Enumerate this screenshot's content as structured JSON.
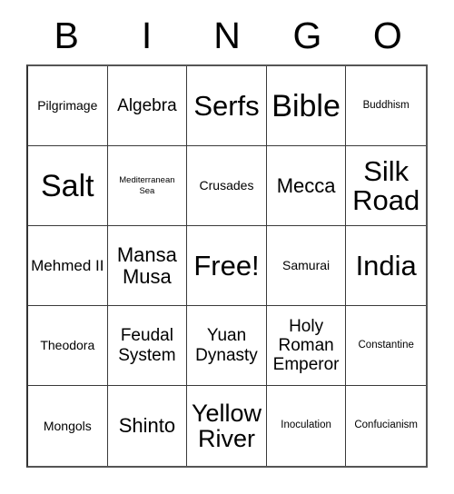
{
  "header": {
    "letters": [
      "B",
      "I",
      "N",
      "G",
      "O"
    ]
  },
  "grid": {
    "rows": 5,
    "columns": 5,
    "cells": [
      {
        "text": "Pilgrimage",
        "size": "fs-s"
      },
      {
        "text": "Algebra",
        "size": "fs-ml"
      },
      {
        "text": "Serfs",
        "size": "fs-xxl"
      },
      {
        "text": "Bible",
        "size": "fs-hg"
      },
      {
        "text": "Buddhism",
        "size": "fs-xs"
      },
      {
        "text": "Salt",
        "size": "fs-hg"
      },
      {
        "text": "Mediterranean Sea",
        "size": "fs-xxs"
      },
      {
        "text": "Crusades",
        "size": "fs-s"
      },
      {
        "text": "Mecca",
        "size": "fs-l"
      },
      {
        "text": "Silk Road",
        "size": "fs-xxl"
      },
      {
        "text": "Mehmed II",
        "size": "fs-m"
      },
      {
        "text": "Mansa Musa",
        "size": "fs-l"
      },
      {
        "text": "Free!",
        "size": "fs-xxl"
      },
      {
        "text": "Samurai",
        "size": "fs-s"
      },
      {
        "text": "India",
        "size": "fs-xxl"
      },
      {
        "text": "Theodora",
        "size": "fs-s"
      },
      {
        "text": "Feudal System",
        "size": "fs-ml"
      },
      {
        "text": "Yuan Dynasty",
        "size": "fs-ml"
      },
      {
        "text": "Holy Roman Emperor",
        "size": "fs-ml"
      },
      {
        "text": "Constantine",
        "size": "fs-xs"
      },
      {
        "text": "Mongols",
        "size": "fs-s"
      },
      {
        "text": "Shinto",
        "size": "fs-l"
      },
      {
        "text": "Yellow River",
        "size": "fs-xl"
      },
      {
        "text": "Inoculation",
        "size": "fs-xs"
      },
      {
        "text": "Confucianism",
        "size": "fs-xs"
      }
    ]
  },
  "colors": {
    "background": "#ffffff",
    "text": "#000000",
    "border": "#3a3a3a"
  }
}
